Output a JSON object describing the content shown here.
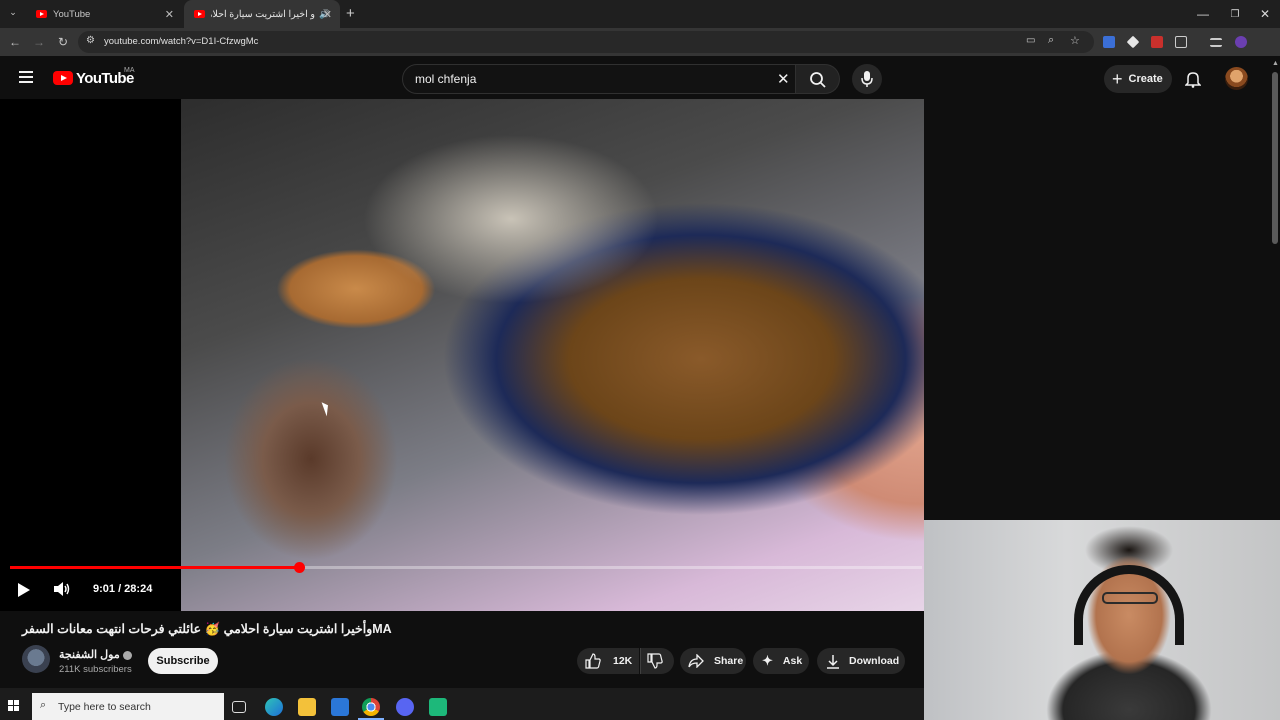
{
  "browser": {
    "tabs": [
      {
        "title": "YouTube"
      },
      {
        "title": "و اخيرا اشتريت سيارة احلامي"
      }
    ],
    "url": "youtube.com/watch?v=D1I-CfzwgMc",
    "window_controls": {
      "minimize": "—",
      "restore": "❐",
      "close": "✕"
    }
  },
  "youtube": {
    "logo_text": "YouTube",
    "country_code": "MA",
    "search_query": "mol chfenja",
    "create_label": "Create"
  },
  "player": {
    "time_display": "9:01 / 28:24",
    "progress_fraction": 0.317
  },
  "video": {
    "title": "وأخيرا اشتريت سيارة احلامي 🥳 عائلتي فرحات انتهت معانات السفرMA",
    "channel_name": "مول الشفنجة",
    "subscribers": "211K subscribers",
    "subscribe_label": "Subscribe",
    "like_count": "12K",
    "share_label": "Share",
    "ask_label": "Ask",
    "download_label": "Download"
  },
  "taskbar": {
    "search_placeholder": "Type here to search"
  },
  "colors": {
    "yt_red": "#ff0000",
    "background": "#0f0f0f",
    "pill": "#272727"
  }
}
